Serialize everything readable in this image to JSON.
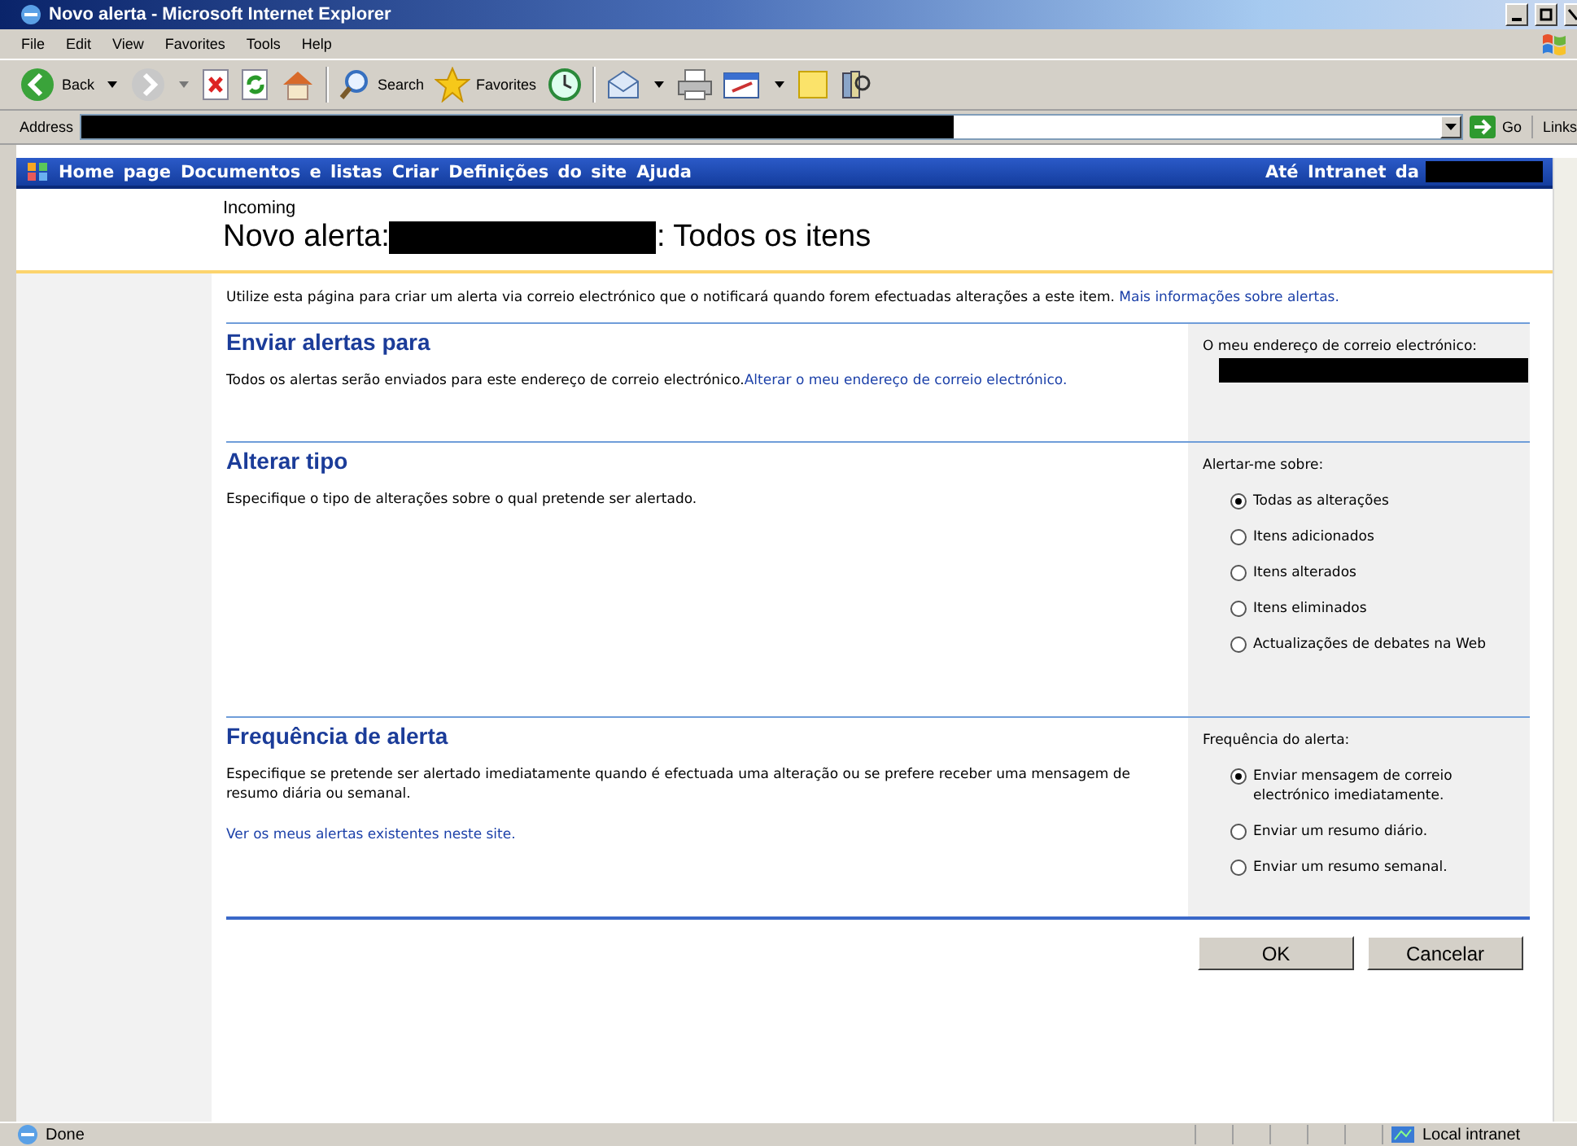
{
  "window": {
    "title": "Novo alerta - Microsoft Internet Explorer"
  },
  "menu": [
    "File",
    "Edit",
    "View",
    "Favorites",
    "Tools",
    "Help"
  ],
  "toolbar": {
    "back": "Back",
    "search": "Search",
    "favorites": "Favorites"
  },
  "address": {
    "label": "Address",
    "go": "Go",
    "links": "Links"
  },
  "site_nav": {
    "items": [
      "Home page",
      "Documentos e listas",
      "Criar",
      "Definições do site",
      "Ajuda"
    ],
    "right": "Até Intranet da"
  },
  "header": {
    "breadcrumb": "Incoming",
    "title_prefix": "Novo alerta:",
    "title_suffix": ": Todos os itens"
  },
  "intro": {
    "text": "Utilize esta página para criar um alerta via correio electrónico que o notificará quando forem efectuadas alterações a este item.",
    "link": "Mais informações sobre alertas."
  },
  "sections": [
    {
      "kind": "email",
      "title": "Enviar alertas para",
      "text": "Todos os alertas serão enviados para este endereço de correio electrónico.",
      "link": "Alterar o meu endereço de correio electrónico.",
      "panel_label": "O meu endereço de correio electrónico:"
    },
    {
      "kind": "options",
      "title": "Alterar tipo",
      "text": "Especifique o tipo de alterações sobre o qual pretende ser alertado.",
      "panel_label": "Alertar-me sobre:",
      "options": [
        {
          "label": "Todas as alterações",
          "selected": true
        },
        {
          "label": "Itens adicionados",
          "selected": false
        },
        {
          "label": "Itens alterados",
          "selected": false
        },
        {
          "label": "Itens eliminados",
          "selected": false
        },
        {
          "label": "Actualizações de debates na Web",
          "selected": false
        }
      ]
    },
    {
      "kind": "options",
      "title": "Frequência de alerta",
      "text": "Especifique se pretende ser alertado imediatamente quando é efectuada uma alteração ou se prefere receber uma mensagem de resumo diária ou semanal.",
      "footer_link": "Ver os meus alertas existentes neste site.",
      "panel_label": "Frequência do alerta:",
      "options": [
        {
          "label": "Enviar mensagem de correio electrónico imediatamente.",
          "selected": true
        },
        {
          "label": "Enviar um resumo diário.",
          "selected": false
        },
        {
          "label": "Enviar um resumo semanal.",
          "selected": false
        }
      ]
    }
  ],
  "buttons": [
    "OK",
    "Cancelar"
  ],
  "status_bar": {
    "text": "Done",
    "zone": "Local intranet"
  }
}
